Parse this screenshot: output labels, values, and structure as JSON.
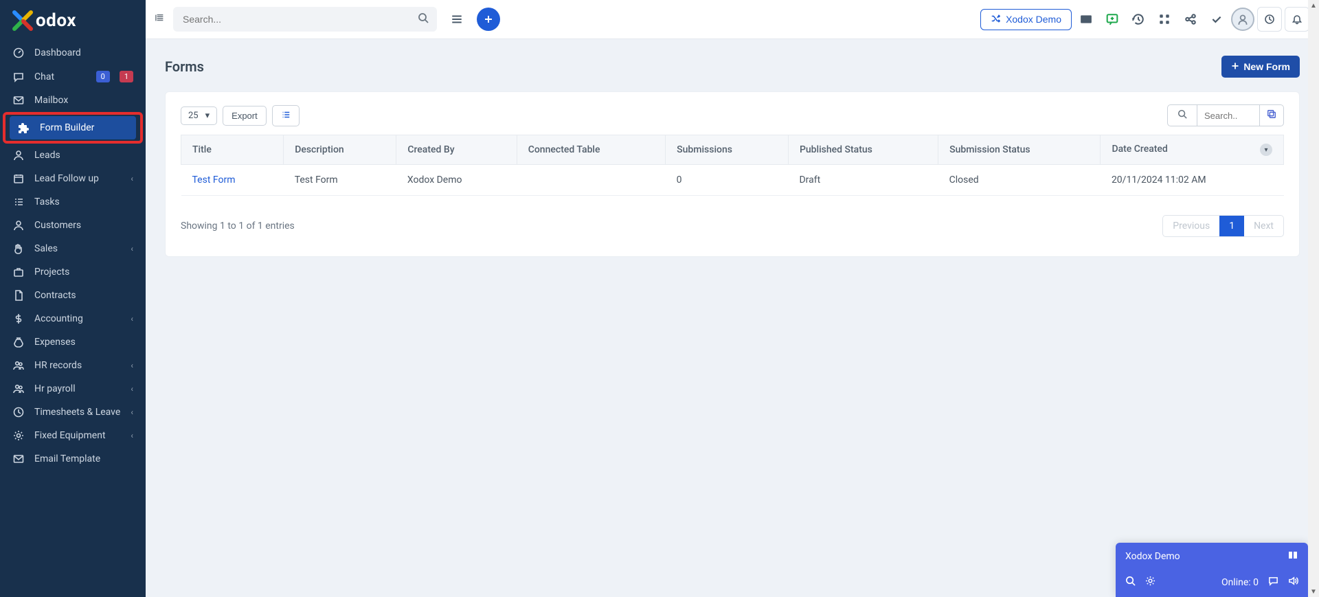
{
  "brand": {
    "name": "odox"
  },
  "sidebar": {
    "items": [
      {
        "id": "dashboard",
        "label": "Dashboard",
        "icon": "gauge",
        "chev": false
      },
      {
        "id": "chat",
        "label": "Chat",
        "icon": "chat",
        "chev": false,
        "badge0": "0",
        "badge1": "1"
      },
      {
        "id": "mailbox",
        "label": "Mailbox",
        "icon": "mail",
        "chev": false
      },
      {
        "id": "form-builder",
        "label": "Form Builder",
        "icon": "puzzle",
        "chev": false,
        "active": true,
        "highlight": true
      },
      {
        "id": "leads",
        "label": "Leads",
        "icon": "leads",
        "chev": false
      },
      {
        "id": "lead-follow",
        "label": "Lead Follow up",
        "icon": "followup",
        "chev": true
      },
      {
        "id": "tasks",
        "label": "Tasks",
        "icon": "tasks",
        "chev": false
      },
      {
        "id": "customers",
        "label": "Customers",
        "icon": "user",
        "chev": false
      },
      {
        "id": "sales",
        "label": "Sales",
        "icon": "hand",
        "chev": true
      },
      {
        "id": "projects",
        "label": "Projects",
        "icon": "brief",
        "chev": false
      },
      {
        "id": "contracts",
        "label": "Contracts",
        "icon": "doc",
        "chev": false
      },
      {
        "id": "accounting",
        "label": "Accounting",
        "icon": "dollar",
        "chev": true
      },
      {
        "id": "expenses",
        "label": "Expenses",
        "icon": "bag",
        "chev": false
      },
      {
        "id": "hr-records",
        "label": "HR records",
        "icon": "group",
        "chev": true
      },
      {
        "id": "hr-payroll",
        "label": "Hr payroll",
        "icon": "group",
        "chev": true
      },
      {
        "id": "timesheets",
        "label": "Timesheets & Leave",
        "icon": "clockuser",
        "chev": true
      },
      {
        "id": "fixed-equip",
        "label": "Fixed Equipment",
        "icon": "gear",
        "chev": true
      },
      {
        "id": "email-tmpl",
        "label": "Email Template",
        "icon": "mail",
        "chev": false
      }
    ]
  },
  "topbar": {
    "search_placeholder": "Search...",
    "demo_label": "Xodox Demo"
  },
  "page": {
    "title": "Forms",
    "new_button": "New Form"
  },
  "table_toolbar": {
    "page_size": "25",
    "export_label": "Export",
    "search_placeholder": "Search.."
  },
  "table": {
    "columns": [
      "Title",
      "Description",
      "Created By",
      "Connected Table",
      "Submissions",
      "Published Status",
      "Submission Status",
      "Date Created"
    ],
    "rows": [
      {
        "title": "Test Form",
        "description": "Test Form",
        "created_by": "Xodox Demo",
        "connected_table": "",
        "submissions": "0",
        "published_status": "Draft",
        "submission_status": "Closed",
        "date_created": "20/11/2024 11:02 AM"
      }
    ],
    "footer_text": "Showing 1 to 1 of 1 entries",
    "pager": {
      "prev": "Previous",
      "pages": [
        "1"
      ],
      "next": "Next"
    }
  },
  "chat_dock": {
    "title": "Xodox Demo",
    "status": "Online: 0"
  }
}
